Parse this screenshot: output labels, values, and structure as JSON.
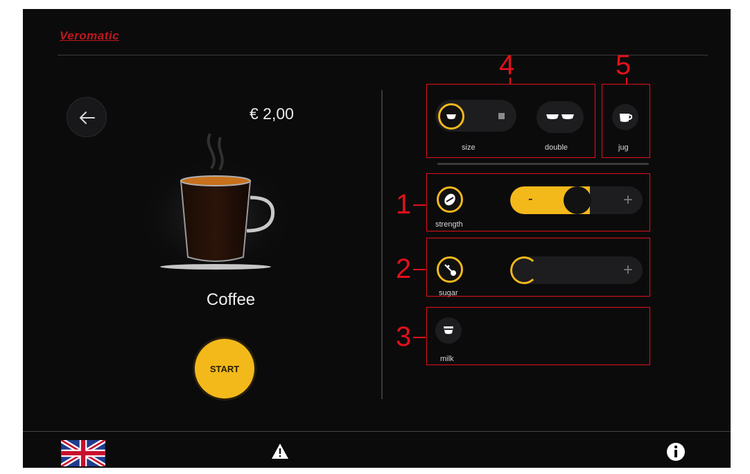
{
  "app": {
    "brand": "Veromatic"
  },
  "product": {
    "price": "€ 2,00",
    "name": "Coffee",
    "start_label": "START"
  },
  "options": {
    "size_label": "size",
    "double_label": "double",
    "jug_label": "jug",
    "strength": {
      "label": "strength",
      "minus": "-",
      "plus": "+",
      "level": 0.5
    },
    "sugar": {
      "label": "sugar",
      "plus": "+",
      "level": 0.0
    },
    "milk": {
      "label": "milk"
    }
  },
  "annotations": [
    "1",
    "2",
    "3",
    "4",
    "5"
  ],
  "footer": {
    "language": "UK flag",
    "icons": [
      "warning-icon",
      "info-icon"
    ]
  },
  "colors": {
    "accent": "#f3b91a",
    "brand_red": "#c0171d",
    "annotation_red": "#e3101a",
    "background": "#0b0b0c"
  }
}
